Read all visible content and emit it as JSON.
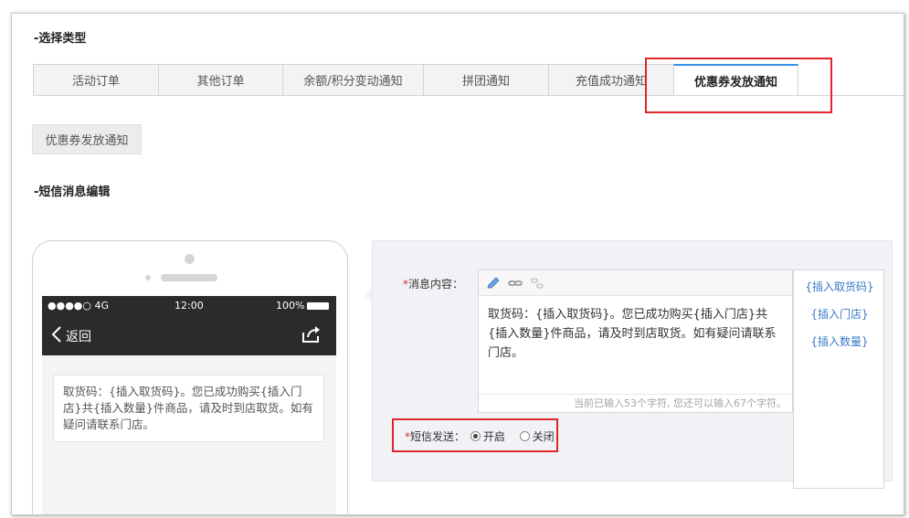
{
  "sections": {
    "select_type": "-选择类型",
    "sms_edit": "-短信消息编辑"
  },
  "tabs": [
    {
      "label": "活动订单",
      "active": false
    },
    {
      "label": "其他订单",
      "active": false
    },
    {
      "label": "余额/积分变动通知",
      "active": false
    },
    {
      "label": "拼团通知",
      "active": false
    },
    {
      "label": "充值成功通知",
      "active": false
    },
    {
      "label": "优惠券发放通知",
      "active": true
    }
  ],
  "subtab": "优惠券发放通知",
  "phone": {
    "carrier": "●●●●○ 4G",
    "time": "12:00",
    "battery": "100%",
    "back_label": "返回",
    "message": "取货码：{插入取货码}。您已成功购买{插入门店}共{插入数量}件商品，请及时到店取货。如有疑问请联系门店。"
  },
  "editor": {
    "content_label": "消息内容：",
    "content": "取货码：{插入取货码}。您已成功购买{插入门店}共{插入数量}件商品，请及时到店取货。如有疑问请联系门店。",
    "counter": "当前已输入53个字符, 您还可以输入67个字符。",
    "toolbar_icons": [
      "pencil-icon",
      "link-icon",
      "unlink-icon"
    ]
  },
  "insert_links": [
    "{插入取货码}",
    "{插入门店}",
    "{插入数量}"
  ],
  "sms_send": {
    "label": "短信发送：",
    "options": [
      "开启",
      "关闭"
    ],
    "selected": "开启"
  },
  "colors": {
    "accent": "#3a8ee6",
    "highlight_box": "#e0262b",
    "link": "#3a78c8",
    "phone_bar": "#2b2b2b"
  }
}
